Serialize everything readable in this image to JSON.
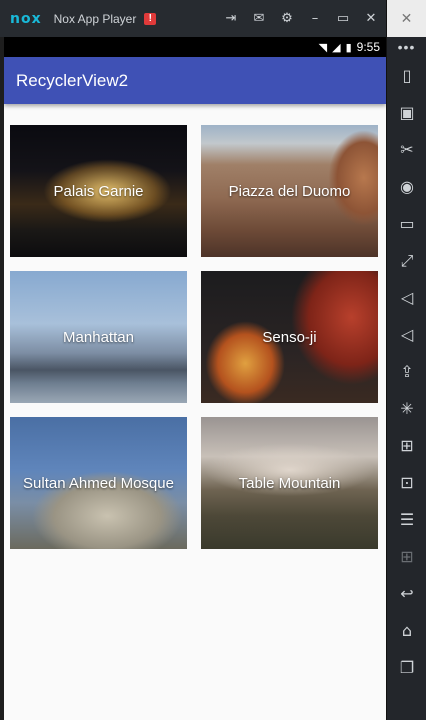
{
  "emulator": {
    "logo": "nox",
    "title": "Nox App Player",
    "warning_badge": "!",
    "controls": [
      "pin-icon",
      "mail-icon",
      "settings-icon",
      "minimize-icon",
      "maximize-icon",
      "close-icon"
    ],
    "side_top_icon": "close-panel-icon",
    "side_more": "•••",
    "sidebar_tools": [
      {
        "icon": "phone-rotate-icon"
      },
      {
        "icon": "robot-icon"
      },
      {
        "icon": "scissors-icon"
      },
      {
        "icon": "location-icon"
      },
      {
        "icon": "screen-icon"
      },
      {
        "icon": "fullscreen-icon"
      },
      {
        "icon": "volume-up-icon"
      },
      {
        "icon": "volume-down-icon"
      },
      {
        "icon": "apk-install-icon"
      },
      {
        "icon": "loading-icon"
      },
      {
        "icon": "shake-icon"
      },
      {
        "icon": "record-icon"
      },
      {
        "icon": "stack-icon"
      },
      {
        "icon": "add-disabled-icon"
      },
      {
        "icon": "back-icon"
      },
      {
        "icon": "home-icon"
      },
      {
        "icon": "recent-apps-icon"
      }
    ]
  },
  "android": {
    "status": {
      "time": "9:55"
    },
    "appbar_title": "RecyclerView2",
    "colors": {
      "primary": "#3f51b5",
      "statusbar": "#000000",
      "background": "#fafafa"
    },
    "cards": [
      {
        "label": "Palais Garnie"
      },
      {
        "label": "Piazza del Duomo"
      },
      {
        "label": "Manhattan"
      },
      {
        "label": "Senso-ji"
      },
      {
        "label": "Sultan Ahmed Mosque"
      },
      {
        "label": "Table Mountain"
      }
    ]
  }
}
